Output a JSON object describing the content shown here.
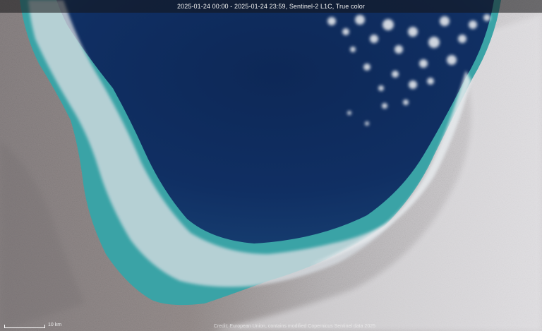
{
  "header": {
    "title": "2025-01-24 00:00 - 2025-01-24 23:59, Sentinel-2 L1C, True color"
  },
  "scale": {
    "label": "10 km"
  },
  "footer": {
    "credit": "Credit: European Union, contains modified Copernicus Sentinel data 2025"
  },
  "colors": {
    "deep_water": "#0e2a5c",
    "shallow_water": "#3aa6a8",
    "land": "#8f8886",
    "snow": "#e9e8ea",
    "ice_cloud": "#d9dde2"
  }
}
